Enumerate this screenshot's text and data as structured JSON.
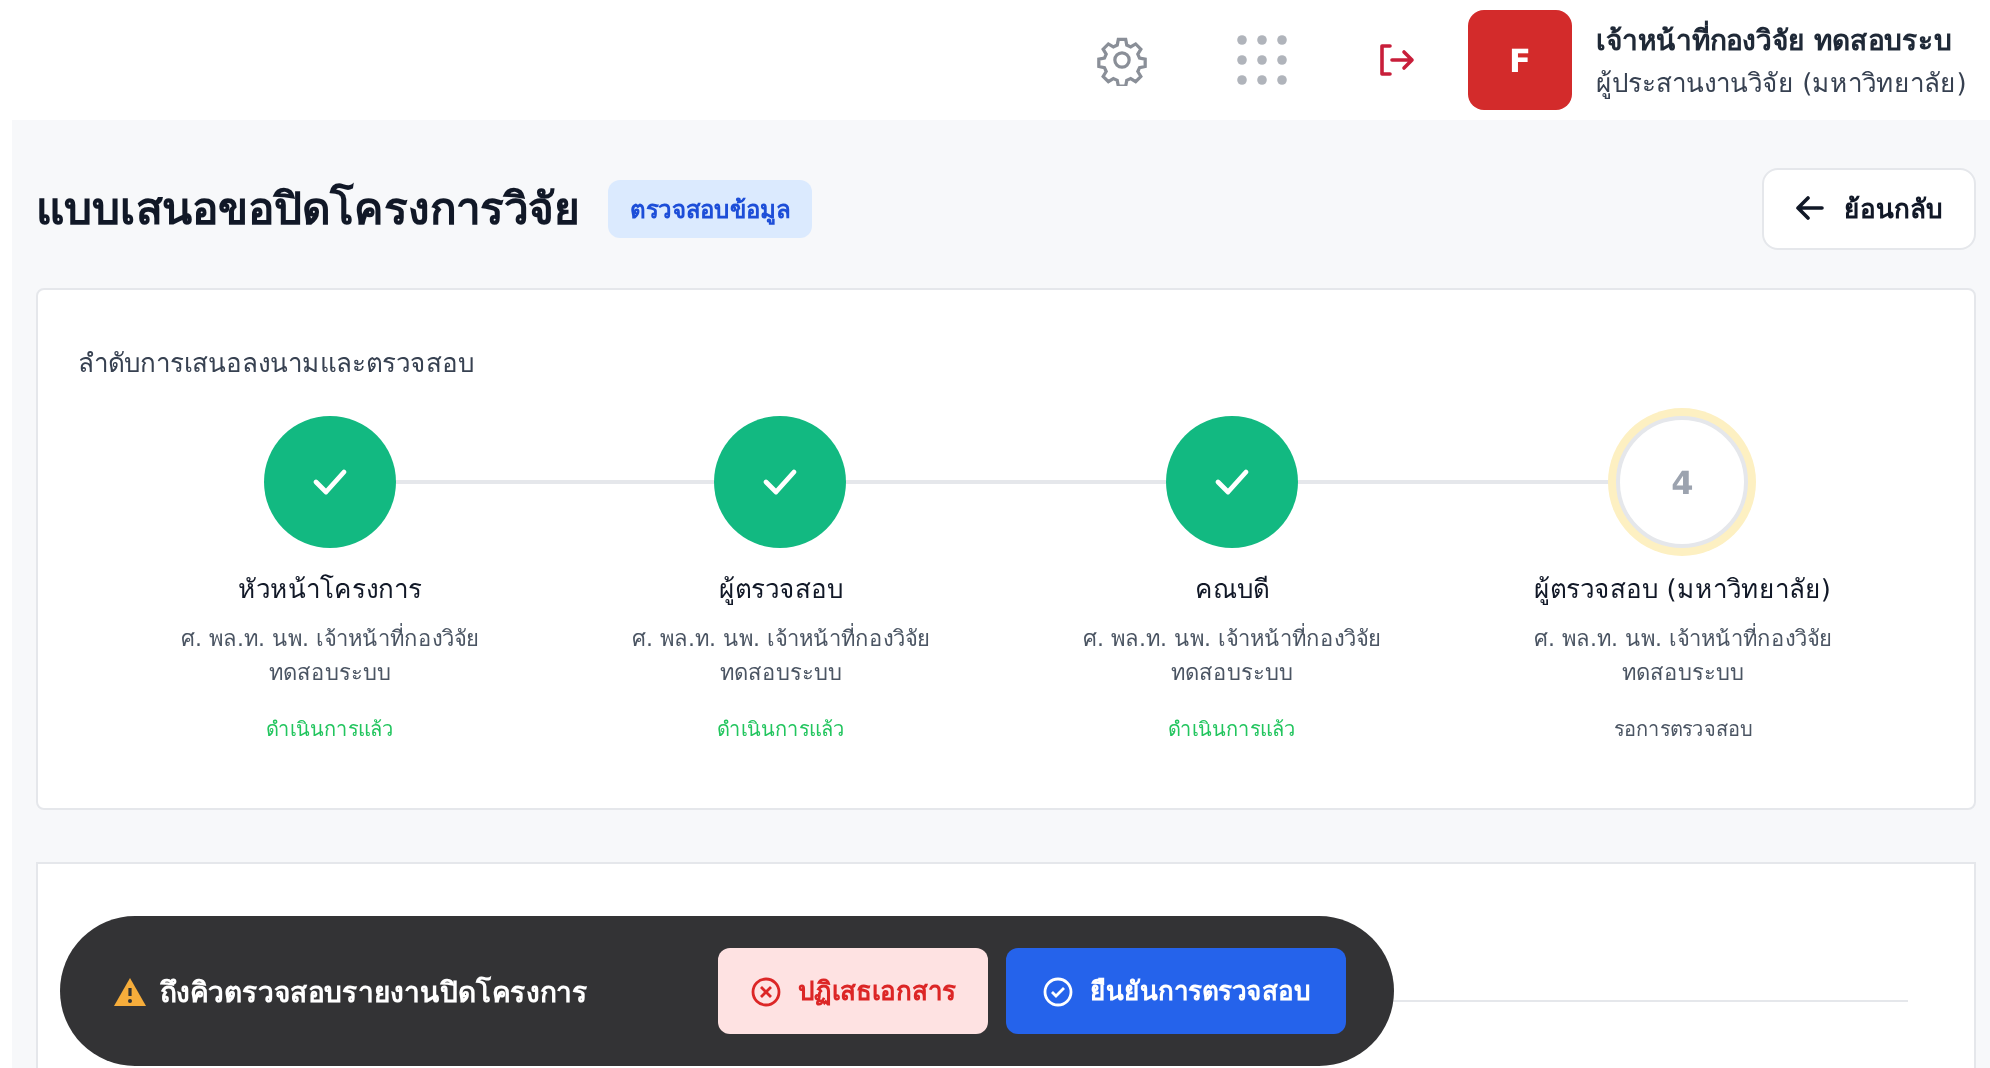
{
  "header": {
    "user": {
      "avatar_letter": "F",
      "name": "เจ้าหน้าที่กองวิจัย ทดสอบระบ",
      "role": "ผู้ประสานงานวิจัย (มหาวิทยาลัย)"
    }
  },
  "page": {
    "title": "แบบเสนอขอปิดโครงการวิจัย",
    "status_badge": "ตรวจสอบข้อมูล",
    "back_button": "ย้อนกลับ"
  },
  "approval_flow": {
    "title": "ลำดับการเสนอลงนามและตรวจสอบ",
    "steps": [
      {
        "kind": "done",
        "role": "หัวหน้าโครงการ",
        "person": "ศ. พล.ท. นพ. เจ้าหน้าที่กองวิจัย ทดสอบระบบ",
        "status": "ดำเนินการแล้ว"
      },
      {
        "kind": "done",
        "role": "ผู้ตรวจสอบ",
        "person": "ศ. พล.ท. นพ. เจ้าหน้าที่กองวิจัย ทดสอบระบบ",
        "status": "ดำเนินการแล้ว"
      },
      {
        "kind": "done",
        "role": "คณบดี",
        "person": "ศ. พล.ท. นพ. เจ้าหน้าที่กองวิจัย ทดสอบระบบ",
        "status": "ดำเนินการแล้ว"
      },
      {
        "kind": "current",
        "number": "4",
        "role": "ผู้ตรวจสอบ (มหาวิทยาลัย)",
        "person": "ศ. พล.ท. นพ. เจ้าหน้าที่กองวิจัย ทดสอบระบบ",
        "status": "รอการตรวจสอบ"
      }
    ]
  },
  "action_bar": {
    "message": "ถึงคิวตรวจสอบรายงานปิดโครงการ",
    "reject_button": "ปฏิเสธเอกสาร",
    "confirm_button": "ยืนยันการตรวจสอบ"
  }
}
